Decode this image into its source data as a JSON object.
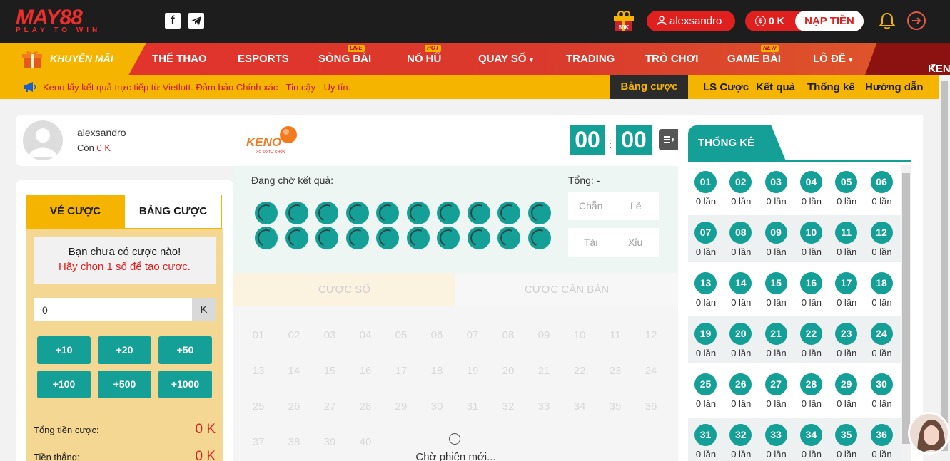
{
  "header": {
    "logo_main": "MAY88",
    "logo_sub": "PLAY TO WIN",
    "username": "alexsandro",
    "balance": "0 K",
    "deposit_label": "NẠP TIỀN",
    "gift_badge": "50K"
  },
  "nav": {
    "promo_label": "KHUYẾN MÃI",
    "items": [
      {
        "label": "THỂ THAO",
        "tag": ""
      },
      {
        "label": "ESPORTS",
        "tag": ""
      },
      {
        "label": "SÒNG BÀI",
        "tag": "LIVE"
      },
      {
        "label": "NỔ HŨ",
        "tag": "HOT"
      },
      {
        "label": "QUAY SỐ",
        "tag": ""
      },
      {
        "label": "TRADING",
        "tag": ""
      },
      {
        "label": "TRÒ CHƠI",
        "tag": ""
      },
      {
        "label": "GAME BÀI",
        "tag": "NEW"
      },
      {
        "label": "LÔ ĐỀ",
        "tag": ""
      },
      {
        "label": "KENO",
        "tag": ""
      }
    ]
  },
  "ticker": {
    "text": "Keno lấy kết quả trực tiếp từ Vietlott. Đảm bảo Chính xác - Tin cậy - Uy tín.",
    "tabs": [
      "Bảng cược",
      "LS Cược",
      "Kết quả",
      "Thống kê",
      "Hướng dẫn"
    ]
  },
  "user_card": {
    "name": "alexsandro",
    "remaining_label": "Còn",
    "remaining_value": "0 K"
  },
  "bet_panel": {
    "tab_ticket": "VÉ CƯỢC",
    "tab_board": "BẢNG CƯỢC",
    "empty_line1": "Bạn chưa có cược nào!",
    "empty_line2": "Hãy chọn 1 số để tạo cược.",
    "amount_value": "0",
    "amount_unit": "K",
    "quick": [
      "+10",
      "+20",
      "+50",
      "+100",
      "+500",
      "+1000"
    ],
    "total_label": "Tổng tiền cược:",
    "total_value": "0 K",
    "win_label": "Tiền thắng:",
    "win_value": "0 K"
  },
  "center": {
    "logo_text": "KENO",
    "logo_sub": "XỔ SỐ TỰ CHỌN",
    "clock_min": "00",
    "clock_sec": "00",
    "clock_sep": ":",
    "waiting_label": "Đang chờ kết quả:",
    "total_label": "Tổng: -",
    "options": [
      [
        "Chẵn",
        "Lẻ"
      ],
      [
        "Tài",
        "Xỉu"
      ]
    ],
    "tab_number": "CƯỢC SỐ",
    "tab_basic": "CƯỢC CĂN BẢN",
    "numbers": [
      "01",
      "02",
      "03",
      "04",
      "05",
      "06",
      "07",
      "08",
      "09",
      "10",
      "11",
      "12",
      "13",
      "14",
      "15",
      "16",
      "17",
      "18",
      "19",
      "20",
      "21",
      "22",
      "23",
      "24",
      "25",
      "26",
      "27",
      "28",
      "29",
      "30",
      "31",
      "32",
      "33",
      "34",
      "35",
      "36",
      "37",
      "38",
      "39",
      "40"
    ],
    "waiting_new": "Chờ phiên mới..."
  },
  "stats": {
    "title": "THỐNG KÊ",
    "numbers": [
      "01",
      "02",
      "03",
      "04",
      "05",
      "06",
      "07",
      "08",
      "09",
      "10",
      "11",
      "12",
      "13",
      "14",
      "15",
      "16",
      "17",
      "18",
      "19",
      "20",
      "21",
      "22",
      "23",
      "24",
      "25",
      "26",
      "27",
      "28",
      "29",
      "30",
      "31",
      "32",
      "33",
      "34",
      "35",
      "36"
    ],
    "count_text": "0 lần"
  },
  "colors": {
    "teal": "#149f97",
    "red": "#e01f1f",
    "gold": "#f5b400",
    "dark": "#1d1d1d"
  }
}
